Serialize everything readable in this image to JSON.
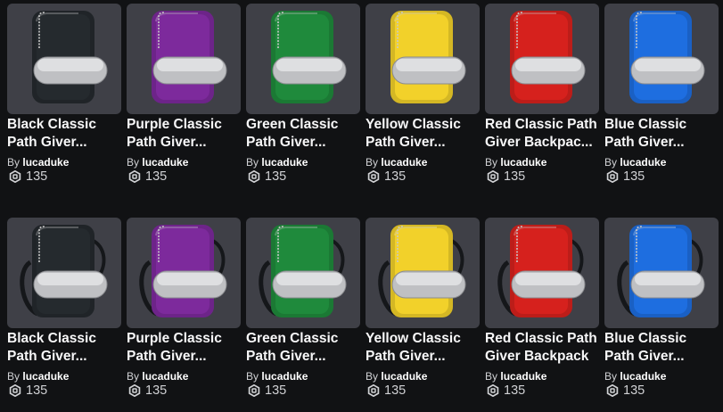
{
  "catalog": {
    "items": [
      {
        "name_line1": "Black Classic",
        "name_line2": "Path Giver...",
        "by_label": "By",
        "creator": "lucaduke",
        "price": "135",
        "color": "#252a2e",
        "strap": false
      },
      {
        "name_line1": "Purple Classic",
        "name_line2": "Path Giver...",
        "by_label": "By",
        "creator": "lucaduke",
        "price": "135",
        "color": "#7d2a9c",
        "strap": false
      },
      {
        "name_line1": "Green Classic",
        "name_line2": "Path Giver...",
        "by_label": "By",
        "creator": "lucaduke",
        "price": "135",
        "color": "#1f8a3c",
        "strap": false
      },
      {
        "name_line1": "Yellow Classic",
        "name_line2": "Path Giver...",
        "by_label": "By",
        "creator": "lucaduke",
        "price": "135",
        "color": "#f2d12a",
        "strap": false
      },
      {
        "name_line1": "Red Classic Path",
        "name_line2": "Giver Backpac...",
        "by_label": "By",
        "creator": "lucaduke",
        "price": "135",
        "color": "#d6211d",
        "strap": false
      },
      {
        "name_line1": "Blue Classic",
        "name_line2": "Path Giver...",
        "by_label": "By",
        "creator": "lucaduke",
        "price": "135",
        "color": "#1e6ee0",
        "strap": false
      },
      {
        "name_line1": "Black Classic",
        "name_line2": "Path Giver...",
        "by_label": "By",
        "creator": "lucaduke",
        "price": "135",
        "color": "#252a2e",
        "strap": true
      },
      {
        "name_line1": "Purple Classic",
        "name_line2": "Path Giver...",
        "by_label": "By",
        "creator": "lucaduke",
        "price": "135",
        "color": "#7d2a9c",
        "strap": true
      },
      {
        "name_line1": "Green Classic",
        "name_line2": "Path Giver...",
        "by_label": "By",
        "creator": "lucaduke",
        "price": "135",
        "color": "#1f8a3c",
        "strap": true
      },
      {
        "name_line1": "Yellow Classic",
        "name_line2": "Path Giver...",
        "by_label": "By",
        "creator": "lucaduke",
        "price": "135",
        "color": "#f2d12a",
        "strap": true
      },
      {
        "name_line1": "Red Classic Path",
        "name_line2": "Giver Backpack",
        "by_label": "By",
        "creator": "lucaduke",
        "price": "135",
        "color": "#d6211d",
        "strap": true
      },
      {
        "name_line1": "Blue Classic",
        "name_line2": "Path Giver...",
        "by_label": "By",
        "creator": "lucaduke",
        "price": "135",
        "color": "#1e6ee0",
        "strap": true
      }
    ]
  },
  "icons": {
    "currency": "robux-icon",
    "item": "backpack-icon"
  }
}
